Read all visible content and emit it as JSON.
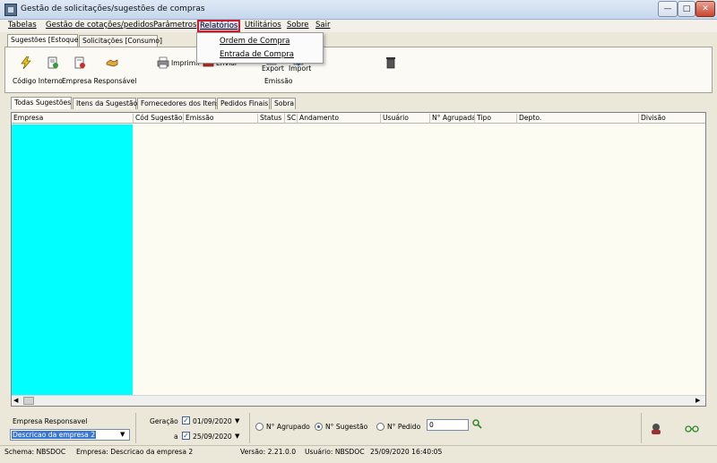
{
  "window": {
    "title": "Gestão de solicitações/sugestões de compras"
  },
  "menu": {
    "items": [
      "Tabelas",
      "Gestão de cotações/pedidos",
      "Parâmetros",
      "Relatórios",
      "Utilitários",
      "Sobre",
      "Sair"
    ],
    "active_dropdown": [
      "Ordem de Compra",
      "Entrada de Compra"
    ]
  },
  "top_tabs": [
    "Sugestões [Estoque]",
    "Solicitações [Consumo]"
  ],
  "toolbar": {
    "print_label": "Imprimir",
    "export_label": "Export",
    "import_label": "Import",
    "obscured_label": "Enviar"
  },
  "info_labels": {
    "codigo": "Código Interno",
    "empresa": "Empresa Responsável",
    "emissao": "Emissão"
  },
  "inner_tabs": [
    "Todas Sugestões",
    "Itens da Sugestão",
    "Fornecedores dos Itens",
    "Pedidos Finais",
    "Sobra"
  ],
  "grid": {
    "columns": [
      "Empresa",
      "Cód Sugestão",
      "Emissão",
      "Status",
      "SC",
      "Andamento",
      "Usuário",
      "N° Agrupada",
      "Tipo",
      "Depto.",
      "Divisão"
    ]
  },
  "filters": {
    "empresa_label": "Empresa Responsavel",
    "empresa_value": "Descricao da empresa 2",
    "geracao_label": "Geração",
    "date_from": "01/09/2020",
    "date_to_prefix": "a",
    "date_to": "25/09/2020",
    "radio_agrupado": "N° Agrupado",
    "radio_sugestao": "N° Sugestão",
    "radio_pedido": "N° Pedido",
    "number_value": "0"
  },
  "status": {
    "schema": "Schema: NBSDOC",
    "empresa": "Empresa: Descricao da empresa 2",
    "versao": "Versão: 2.21.0.0",
    "usuario": "Usuário: NBSDOC",
    "datetime": "25/09/2020 16:40:05"
  },
  "colors": {
    "accent_highlight": "#00ffff",
    "menu_active_border": "#cc1f2c"
  }
}
